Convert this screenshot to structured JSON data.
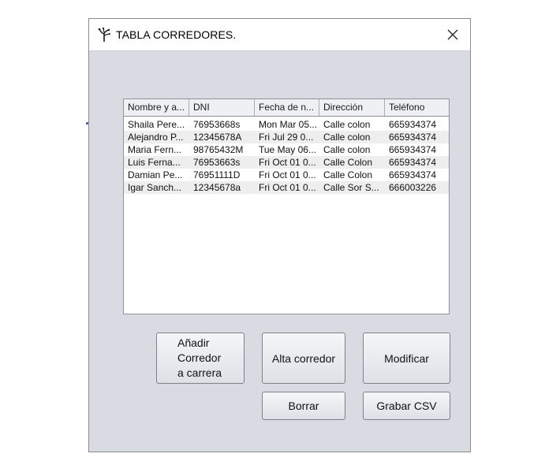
{
  "window": {
    "title": "TABLA CORREDORES.",
    "icon": "sprout-icon",
    "close_icon": "close-icon"
  },
  "table": {
    "columns": [
      "Nombre y a...",
      "DNI",
      "Fecha de n...",
      "Dirección",
      "Teléfono"
    ],
    "rows": [
      [
        "Shaila Pere...",
        "76953668s",
        "Mon Mar 05...",
        "Calle colon",
        "665934374"
      ],
      [
        "Alejandro P...",
        "12345678A",
        "Fri Jul 29 0...",
        "Calle colon",
        "665934374"
      ],
      [
        "Maria Fern...",
        "98765432M",
        "Tue May 06...",
        "Calle colon",
        "665934374"
      ],
      [
        "Luis Ferna...",
        "76953663s",
        "Fri Oct 01 0...",
        "Calle Colon",
        "665934374"
      ],
      [
        "Damian Pe...",
        "76951111D",
        "Fri Oct 01 0...",
        "Calle Colon",
        "665934374"
      ],
      [
        "Igar Sanch...",
        "12345678a",
        "Fri Oct 01 0...",
        "Calle Sor S...",
        "666003226"
      ]
    ]
  },
  "buttons": {
    "add_to_race": "Añadir\nCorredor\na carrera",
    "register": "Alta corredor",
    "modify": "Modificar",
    "delete": "Borrar",
    "save_csv": "Grabar CSV"
  }
}
